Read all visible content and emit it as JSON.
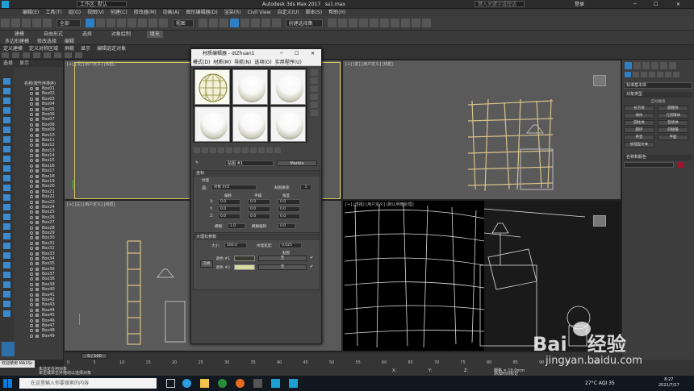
{
  "window": {
    "title": "Autodesk 3ds Max 2017",
    "file": "ss1.max",
    "workspace": "工作区: 默认",
    "search_placeholder": "键入关键字或短语",
    "user": "登录"
  },
  "menus": [
    "编辑(E)",
    "工具(T)",
    "组(G)",
    "视图(V)",
    "创建(C)",
    "修改器(M)",
    "动画(A)",
    "图形编辑器(D)",
    "渲染(R)",
    "Civil View",
    "自定义(U)",
    "脚本(S)",
    "帮助(H)"
  ],
  "toolbar": {
    "filter": "全部",
    "view": "视图",
    "selection_set": "创建选择集"
  },
  "ribbon_tabs": [
    "建模",
    "自由形式",
    "选择",
    "对象绘制",
    "填充"
  ],
  "ribbon2": [
    "多边形建模",
    "修改选择",
    "编辑",
    "几何体(全部)",
    "细分",
    "对齐",
    "属性"
  ],
  "ribbon2_sub": [
    "定义建模",
    "定义对称区域",
    "屏蔽",
    "显示",
    "编辑选定对象"
  ],
  "scene_explorer": {
    "tabs": [
      "选择",
      "显示"
    ],
    "header": "名称(按升序排序)",
    "items": [
      "Box01",
      "Box02",
      "Box03",
      "Box04",
      "Box05",
      "Box06",
      "Box07",
      "Box08",
      "Box09",
      "Box10",
      "Box11",
      "Box12",
      "Box13",
      "Box14",
      "Box15",
      "Box16",
      "Box17",
      "Box18",
      "Box19",
      "Box20",
      "Box21",
      "Box22",
      "Box23",
      "Box24",
      "Box25",
      "Box26",
      "Box27",
      "Box28",
      "Box29",
      "Box30",
      "Box31",
      "Box32",
      "Box33",
      "Box34",
      "Box35",
      "Box36",
      "Box37",
      "Box38",
      "Box39",
      "Box40",
      "Box41",
      "Box42",
      "Box43",
      "Box44",
      "Box45",
      "Box46",
      "Box47",
      "Box48",
      "Box49"
    ]
  },
  "viewports": {
    "top": "[+] [顶] [用户定义] [线框]",
    "front": "[+] [前] [用户定义] [线框]",
    "left": "[+] [左] [用户定义] [线框]",
    "persp": "[+] [透视] [用户定义] [默认明暗处理]"
  },
  "material_editor": {
    "title": "材质编辑器 - diZhuan1",
    "menu": [
      "模式(D)",
      "材质(M)",
      "导航(N)",
      "选项(O)",
      "实用程序(U)"
    ],
    "map_label": "贴图 #1",
    "map_type": "Marble",
    "coords_title": "坐标",
    "texture_label": "纹理",
    "source_label": "源:",
    "source_value": "对象 XYZ",
    "map_channel_label": "贴图通道:",
    "map_channel_value": "1",
    "offset_header": "偏移",
    "tiling_header": "平铺",
    "angle_header": "角度",
    "xyz": [
      "X:",
      "Y:",
      "Z:"
    ],
    "offset": [
      "0.0",
      "0.0",
      "0.0"
    ],
    "tiling": [
      "0.0",
      "0.0",
      "0.0"
    ],
    "angle": [
      "0.0",
      "0.0",
      "0.0"
    ],
    "blur_label": "模糊:",
    "blur_value": "1.0",
    "blur_offset_label": "模糊偏移:",
    "blur_offset_value": "0.0",
    "params_title": "大理石参数",
    "size_label": "大小:",
    "size_value": "100.0",
    "vein_label": "纹理宽度:",
    "vein_value": "0.025",
    "maps_label": "贴图",
    "swap_label": "交换",
    "color1_label": "颜色 #1",
    "color2_label": "颜色 #2",
    "color1": "#3a3a2c",
    "color2": "#d7dca0",
    "none_label": "无"
  },
  "command_panel": {
    "dropdown": "标准基本体",
    "rollout_object_type": "对象类型",
    "autogrid": "自动栅格",
    "buttons": [
      "长方体",
      "圆锥体",
      "球体",
      "几何球体",
      "圆柱体",
      "管状体",
      "圆环",
      "四棱锥",
      "茶壶",
      "平面",
      "加强型文本"
    ],
    "rollout_name_color": "名称和颜色",
    "name_color": "#a0102a"
  },
  "timeline": {
    "frame": "0 / 100",
    "ticks": [
      "0",
      "5",
      "10",
      "15",
      "20",
      "25",
      "30",
      "35",
      "40",
      "45",
      "50",
      "55",
      "60",
      "65",
      "70",
      "75",
      "80",
      "85",
      "90",
      "95",
      "100"
    ]
  },
  "status": {
    "welcome": "欢迎使用 MAXSc",
    "line1": "未选定任何对象",
    "line2": "单击或单击并拖动以选择对象",
    "x_label": "X:",
    "y_label": "Y:",
    "z_label": "Z:",
    "grid": "栅格 = 10.0mm",
    "add_time_tag": "添加时间标记"
  },
  "taskbar": {
    "search_placeholder": "在这里输入你要搜索的内容",
    "weather": "27°C AQI 35",
    "time": "8:27",
    "date": "2021/7/17"
  },
  "watermark": "Baidu经验 jingyan.baidu.com",
  "colors": {
    "accent": "#2e7fc4",
    "wood": "#d8c38a"
  }
}
